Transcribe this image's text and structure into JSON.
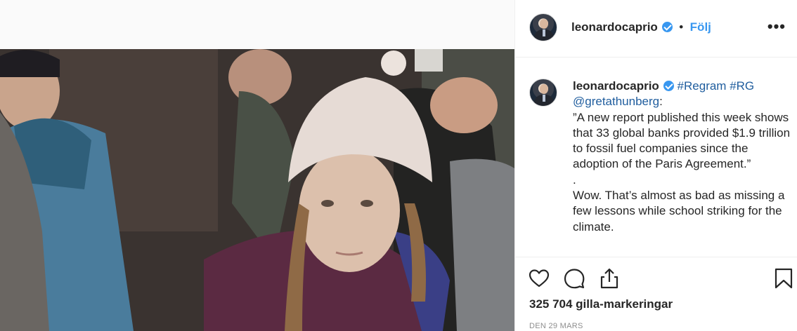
{
  "post": {
    "username": "leonardocaprio",
    "separator": "•",
    "follow_label": "Följ",
    "more_label": "•••"
  },
  "caption": {
    "username": "leonardocaprio",
    "hashtag_regram": "#Regram",
    "hashtag_rg": "#RG",
    "mention": "@gretathunberg",
    "mention_colon": ":",
    "quote": "”A new report published this week shows that 33 global banks provided $1.9 trillion to fossil fuel companies since the adoption of the Paris Agreement.”",
    "dot_line": ".",
    "comment": "Wow. That’s almost as bad as missing a few lessons while school striking for the climate."
  },
  "stats": {
    "likes": "325 704 gilla-markeringar",
    "date": "DEN 29 MARS"
  },
  "icons": {
    "like": "heart-icon",
    "comment": "comment-bubble-icon",
    "share": "share-upload-icon",
    "save": "bookmark-icon"
  },
  "colors": {
    "link": "#3897f0",
    "verified": "#3897f0",
    "text": "#262626",
    "muted": "#8e8e8e",
    "border": "#efefef"
  }
}
